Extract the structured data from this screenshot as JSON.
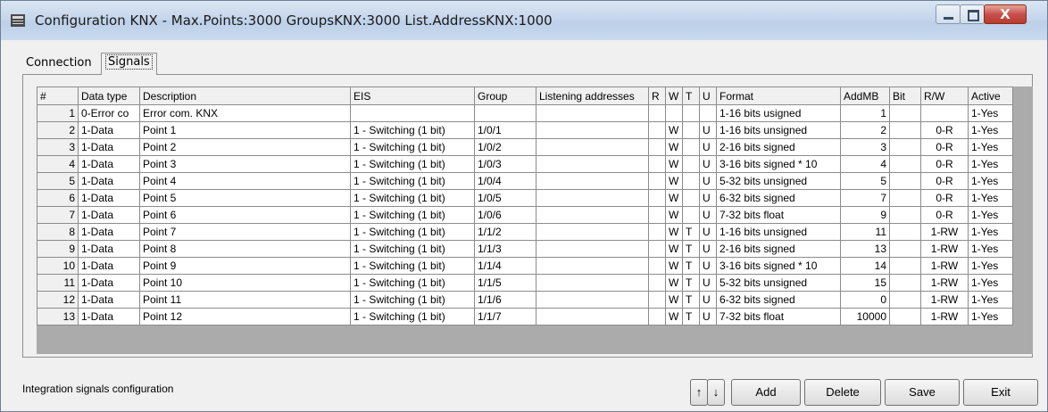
{
  "window": {
    "title": "Configuration KNX - Max.Points:3000 GroupsKNX:3000 List.AddressKNX:1000",
    "close_glyph": "X"
  },
  "tabs": [
    {
      "label": "Connection"
    },
    {
      "label": "Signals"
    }
  ],
  "table": {
    "columns": [
      "#",
      "Data type",
      "Description",
      "EIS",
      "Group",
      "Listening addresses",
      "R",
      "W",
      "T",
      "U",
      "Format",
      "AddMB",
      "Bit",
      "R/W",
      "Active"
    ],
    "rows": [
      [
        "1",
        "0-Error co",
        "Error com. KNX",
        "",
        "",
        "",
        "",
        "",
        "",
        "",
        "1-16 bits usigned",
        "1",
        "",
        "",
        "1-Yes"
      ],
      [
        "2",
        "1-Data",
        "Point 1",
        "1 - Switching (1 bit)",
        "1/0/1",
        "",
        "",
        "W",
        "",
        "U",
        "1-16 bits unsigned",
        "2",
        "",
        "0-R",
        "1-Yes"
      ],
      [
        "3",
        "1-Data",
        "Point 2",
        "1 - Switching (1 bit)",
        "1/0/2",
        "",
        "",
        "W",
        "",
        "U",
        "2-16 bits signed",
        "3",
        "",
        "0-R",
        "1-Yes"
      ],
      [
        "4",
        "1-Data",
        "Point 3",
        "1 - Switching (1 bit)",
        "1/0/3",
        "",
        "",
        "W",
        "",
        "U",
        "3-16 bits signed * 10",
        "4",
        "",
        "0-R",
        "1-Yes"
      ],
      [
        "5",
        "1-Data",
        "Point 4",
        "1 - Switching (1 bit)",
        "1/0/4",
        "",
        "",
        "W",
        "",
        "U",
        "5-32 bits unsigned",
        "5",
        "",
        "0-R",
        "1-Yes"
      ],
      [
        "6",
        "1-Data",
        "Point 5",
        "1 - Switching (1 bit)",
        "1/0/5",
        "",
        "",
        "W",
        "",
        "U",
        "6-32 bits signed",
        "7",
        "",
        "0-R",
        "1-Yes"
      ],
      [
        "7",
        "1-Data",
        "Point 6",
        "1 - Switching (1 bit)",
        "1/0/6",
        "",
        "",
        "W",
        "",
        "U",
        "7-32 bits float",
        "9",
        "",
        "0-R",
        "1-Yes"
      ],
      [
        "8",
        "1-Data",
        "Point 7",
        "1 - Switching (1 bit)",
        "1/1/2",
        "",
        "",
        "W",
        "T",
        "U",
        "1-16 bits unsigned",
        "11",
        "",
        "1-RW",
        "1-Yes"
      ],
      [
        "9",
        "1-Data",
        "Point 8",
        "1 - Switching (1 bit)",
        "1/1/3",
        "",
        "",
        "W",
        "T",
        "U",
        "2-16 bits signed",
        "13",
        "",
        "1-RW",
        "1-Yes"
      ],
      [
        "10",
        "1-Data",
        "Point 9",
        "1 - Switching (1 bit)",
        "1/1/4",
        "",
        "",
        "W",
        "T",
        "U",
        "3-16 bits signed * 10",
        "14",
        "",
        "1-RW",
        "1-Yes"
      ],
      [
        "11",
        "1-Data",
        "Point 10",
        "1 - Switching (1 bit)",
        "1/1/5",
        "",
        "",
        "W",
        "T",
        "U",
        "5-32 bits unsigned",
        "15",
        "",
        "1-RW",
        "1-Yes"
      ],
      [
        "12",
        "1-Data",
        "Point 11",
        "1 - Switching (1 bit)",
        "1/1/6",
        "",
        "",
        "W",
        "T",
        "U",
        "6-32 bits signed",
        "0",
        "",
        "1-RW",
        "1-Yes"
      ],
      [
        "13",
        "1-Data",
        "Point 12",
        "1 - Switching (1 bit)",
        "1/1/7",
        "",
        "",
        "W",
        "T",
        "U",
        "7-32 bits float",
        "10000",
        "",
        "1-RW",
        "1-Yes"
      ]
    ]
  },
  "status": "Integration signals configuration",
  "buttons": {
    "up": "↑",
    "down": "↓",
    "add": "Add",
    "delete": "Delete",
    "save": "Save",
    "exit": "Exit"
  }
}
